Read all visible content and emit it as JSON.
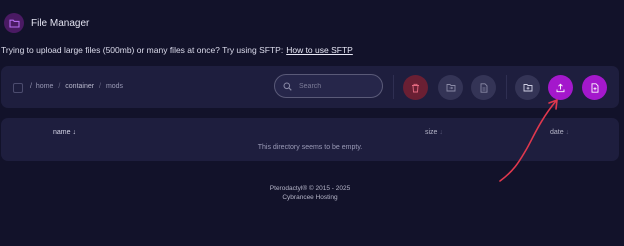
{
  "header": {
    "title": "File Manager",
    "icon": "folder-icon",
    "icon_color": "#a855f7"
  },
  "notice": {
    "text": "Trying to upload large files (500mb) or many files at once? Try using SFTP:",
    "link": "How to use SFTP"
  },
  "breadcrumb": {
    "lead": "/",
    "items": [
      "home",
      "container",
      "mods"
    ],
    "separator": "/"
  },
  "search": {
    "placeholder": "Search"
  },
  "toolbar_icons": [
    "trash-icon",
    "move-icon",
    "file-icon",
    "new-folder-icon",
    "upload-icon",
    "new-file-icon"
  ],
  "table": {
    "columns": [
      "name",
      "size",
      "date"
    ],
    "sort_indicator": "↓",
    "empty_text": "This directory seems to be empty."
  },
  "footer": {
    "line1": "Pterodactyl® © 2015 - 2025",
    "line2": "Cybrancee Hosting"
  },
  "colors": {
    "background": "#12122a",
    "panel": "#1e1e3e",
    "accent": "#a418cc",
    "danger": "#6a1f33",
    "annotation_arrow": "#e0384e"
  }
}
